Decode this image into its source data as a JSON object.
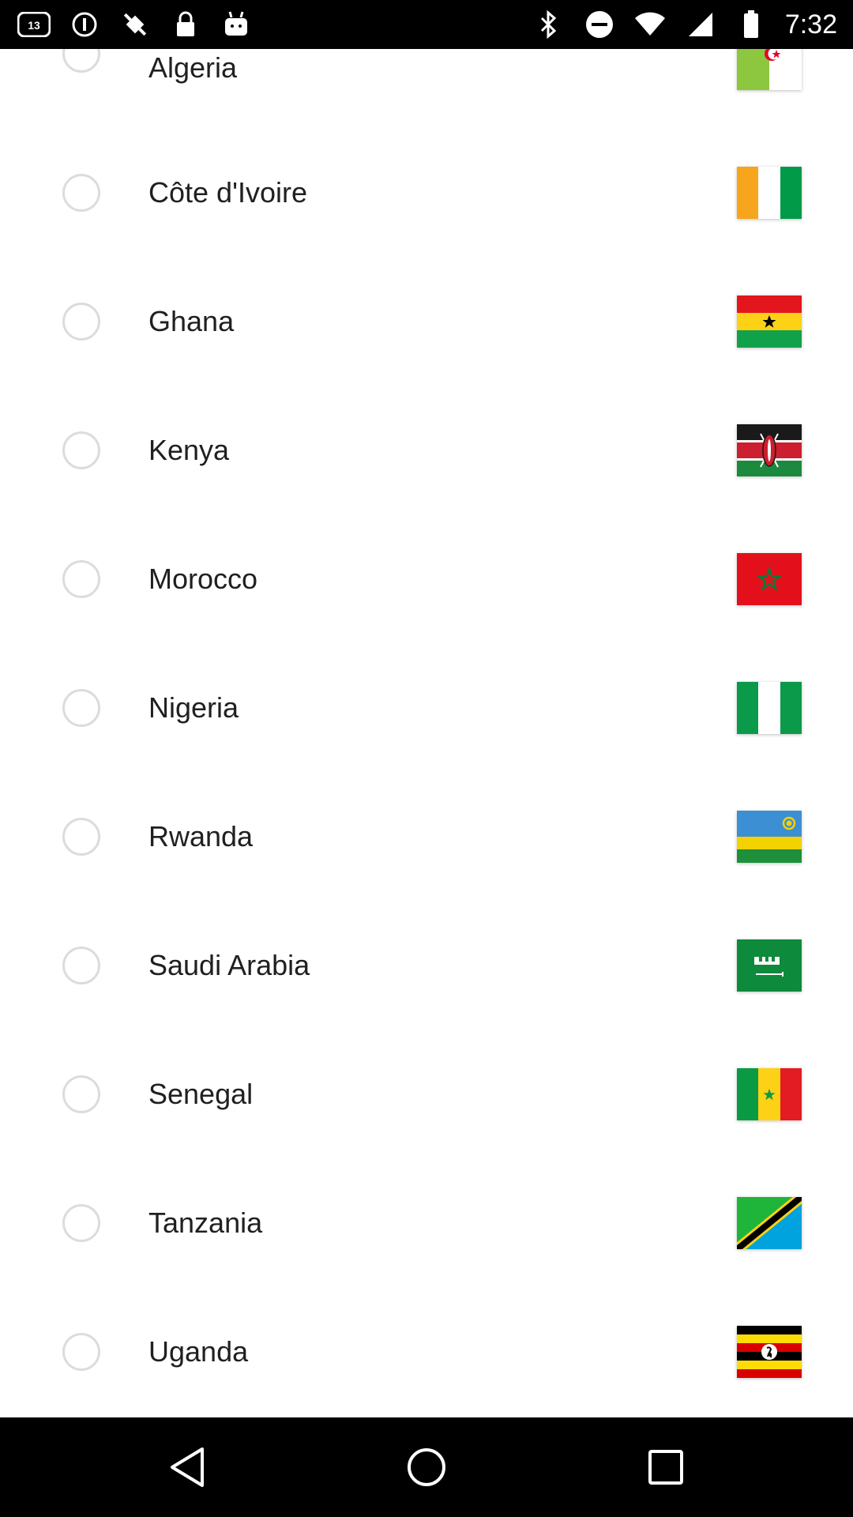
{
  "status_bar": {
    "time": "7:32",
    "left_icons": [
      "abc13-icon",
      "do-not-disturb-icon",
      "fake-gps-icon",
      "lock-icon",
      "android-icon"
    ],
    "right_icons": [
      "bluetooth-icon",
      "minus-circle-icon",
      "wifi-icon",
      "signal-icon",
      "battery-icon"
    ]
  },
  "countries": [
    {
      "name": "Algeria",
      "flag": "algeria-flag"
    },
    {
      "name": "Côte d'Ivoire",
      "flag": "cote-divoire-flag"
    },
    {
      "name": "Ghana",
      "flag": "ghana-flag"
    },
    {
      "name": "Kenya",
      "flag": "kenya-flag"
    },
    {
      "name": "Morocco",
      "flag": "morocco-flag"
    },
    {
      "name": "Nigeria",
      "flag": "nigeria-flag"
    },
    {
      "name": "Rwanda",
      "flag": "rwanda-flag"
    },
    {
      "name": "Saudi Arabia",
      "flag": "saudi-arabia-flag"
    },
    {
      "name": "Senegal",
      "flag": "senegal-flag"
    },
    {
      "name": "Tanzania",
      "flag": "tanzania-flag"
    },
    {
      "name": "Uganda",
      "flag": "uganda-flag"
    }
  ],
  "nav_bar": {
    "buttons": [
      "back-icon",
      "home-icon",
      "recents-icon"
    ]
  },
  "colors": {
    "radio_border": "#dcdcdc",
    "text": "#202020",
    "bars": "#000000"
  }
}
